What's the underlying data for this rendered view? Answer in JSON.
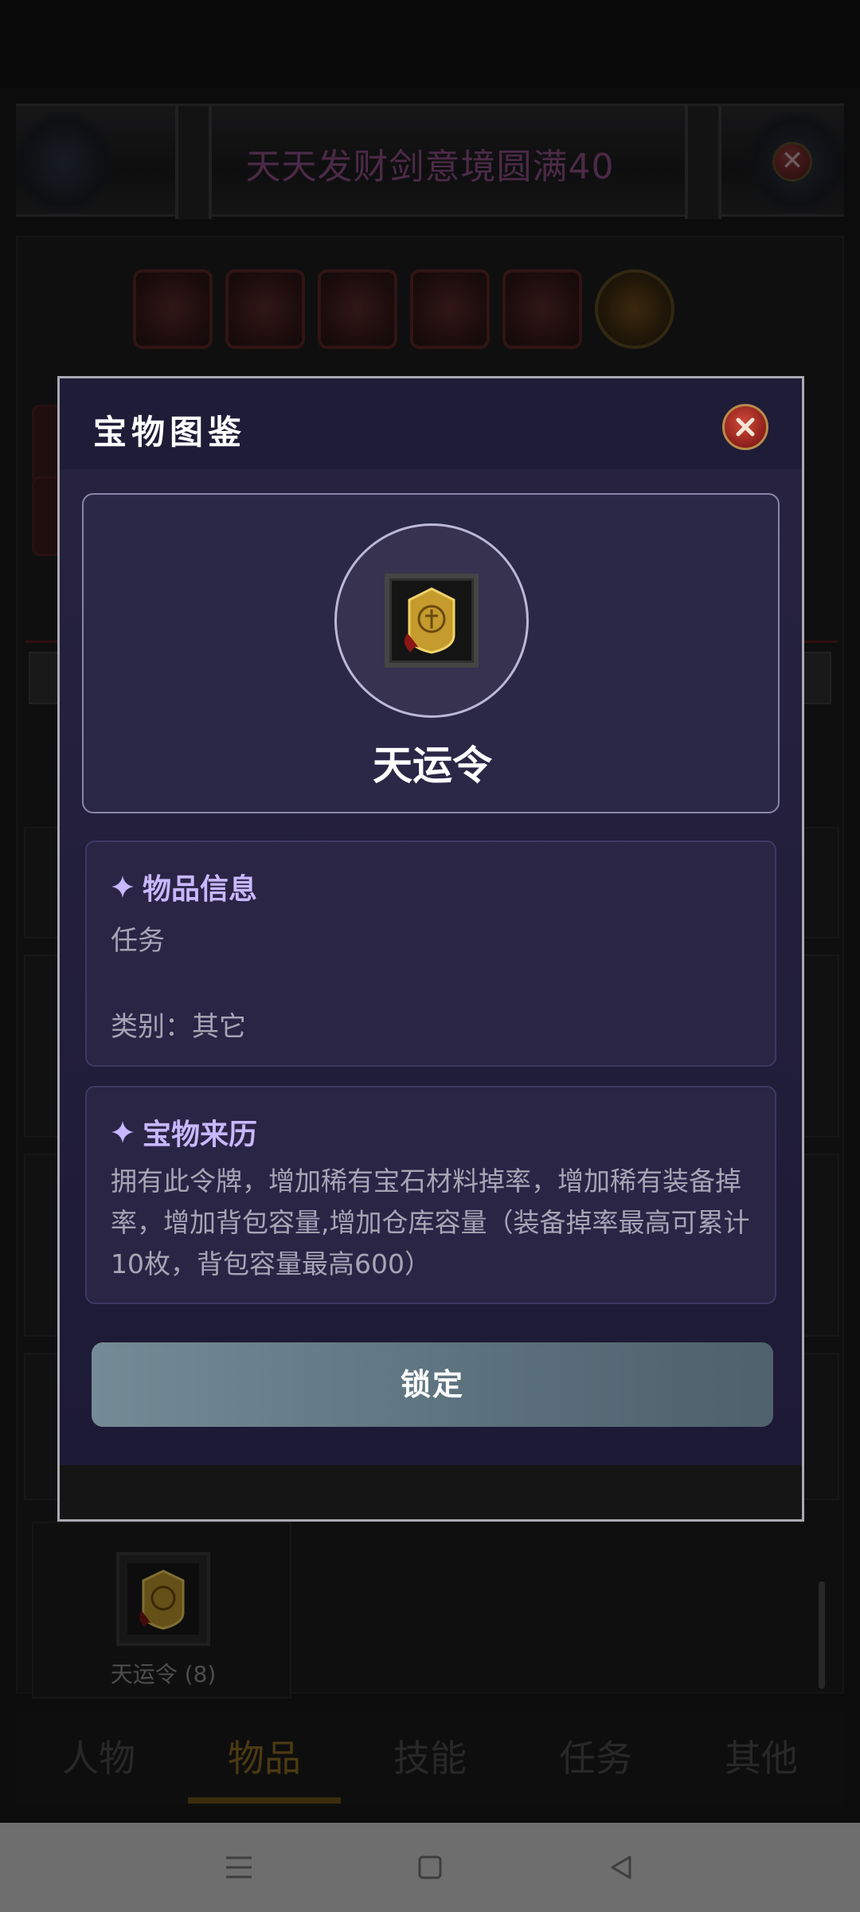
{
  "background": {
    "game_title": "天天发财剑意境圆满40",
    "header_close_glyph": "✕",
    "item": {
      "label": "天运令 (8)"
    },
    "bottom_nav": [
      {
        "label": "人物",
        "active": false
      },
      {
        "label": "物品",
        "active": true
      },
      {
        "label": "技能",
        "active": false
      },
      {
        "label": "任务",
        "active": false
      },
      {
        "label": "其他",
        "active": false
      }
    ],
    "colors": {
      "accent_gold": "#8a6a22",
      "title_purple": "#8a4d82"
    }
  },
  "modal": {
    "title": "宝物图鉴",
    "item_name": "天运令",
    "info_section": {
      "heading": "物品信息",
      "type_text": "任务",
      "category_text": "类别：其它"
    },
    "history_section": {
      "heading": "宝物来历",
      "description": "拥有此令牌，增加稀有宝石材料掉率，增加稀有装备掉率，增加背包容量,增加仓库容量（装备掉率最高可累计10枚，背包容量最高600）"
    },
    "lock_button": "锁定",
    "colors": {
      "heading": "#c7b8ff",
      "background": "#1c1a33",
      "button": "#6a808b"
    }
  },
  "icons": {
    "modal_close": "close-icon",
    "sparkle": "sparkle-icon",
    "item": "token-icon",
    "sys_menu": "menu-icon",
    "sys_home": "home-icon",
    "sys_back": "back-icon"
  }
}
